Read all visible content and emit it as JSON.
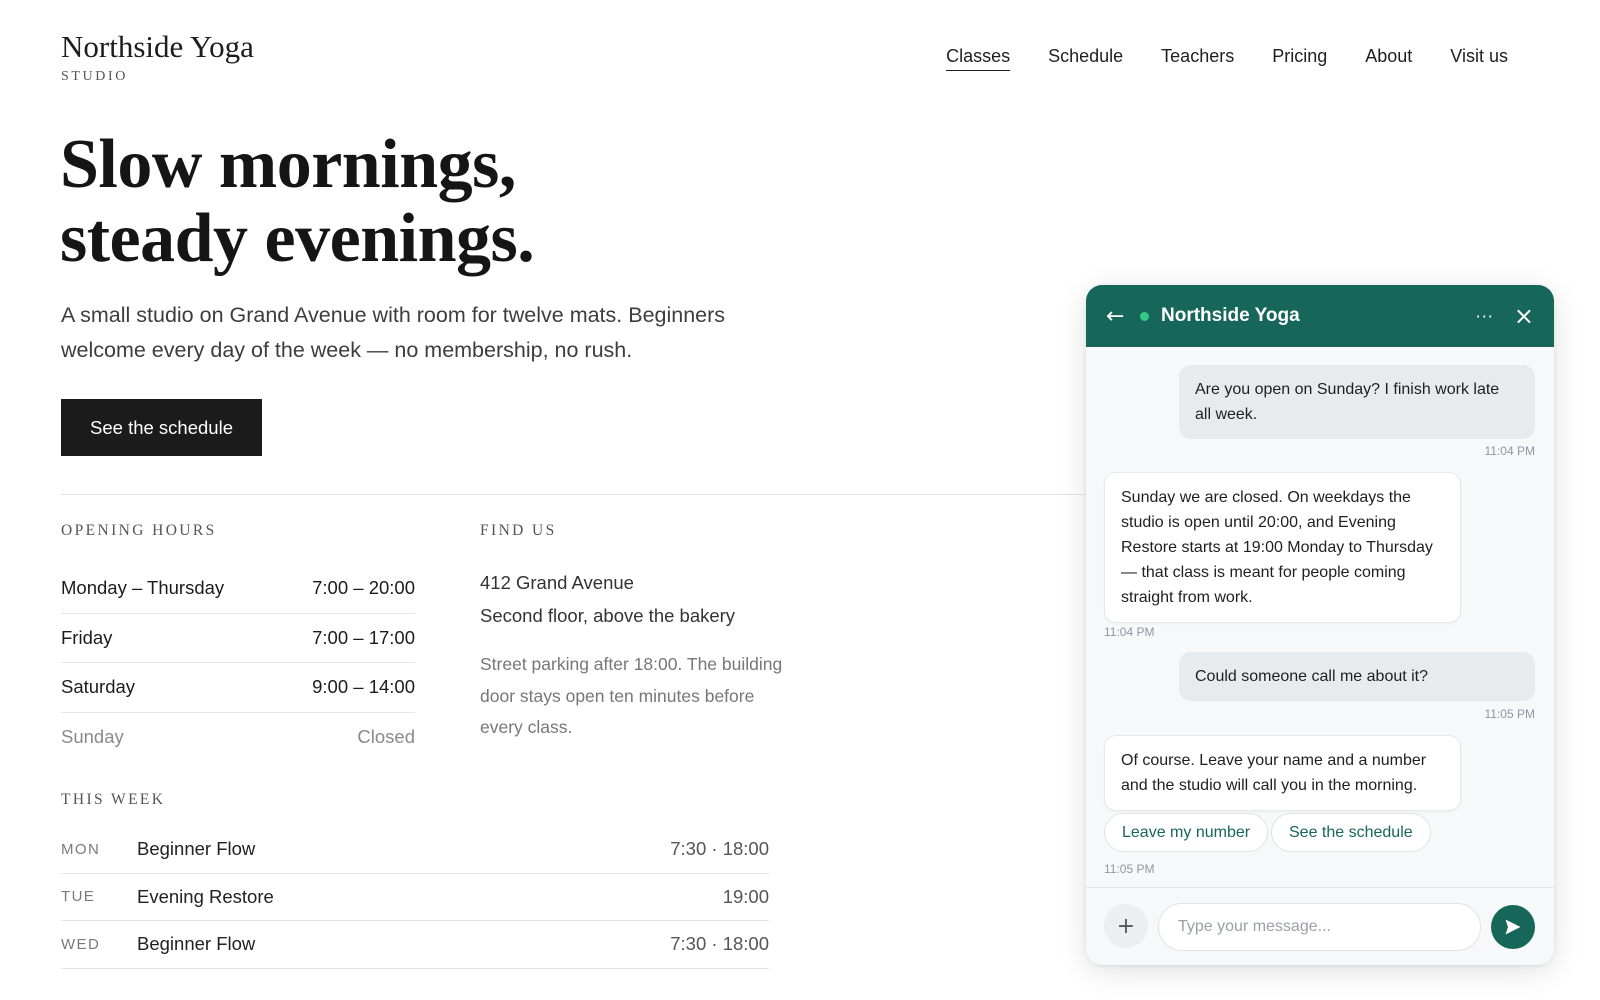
{
  "brand": {
    "name": "Northside Yoga",
    "subtitle": "STUDIO"
  },
  "nav": {
    "items": [
      {
        "label": "Classes",
        "active": true
      },
      {
        "label": "Schedule"
      },
      {
        "label": "Teachers"
      },
      {
        "label": "Pricing"
      },
      {
        "label": "About"
      },
      {
        "label": "Visit us"
      }
    ]
  },
  "hero": {
    "title_line1": "Slow mornings,",
    "title_line2": "steady evenings.",
    "text": "A small studio on Grand Avenue with room for twelve mats. Beginners welcome every day of the week — no membership, no rush.",
    "cta": "See the schedule"
  },
  "hours": {
    "label": "OPENING HOURS",
    "rows": [
      {
        "day": "Monday – Thursday",
        "time": "7:00 – 20:00"
      },
      {
        "day": "Friday",
        "time": "7:00 – 17:00"
      },
      {
        "day": "Saturday",
        "time": "9:00 – 14:00"
      },
      {
        "day": "Sunday",
        "time": "Closed"
      }
    ]
  },
  "find_us": {
    "label": "FIND US",
    "address_line1": "412 Grand Avenue",
    "address_line2": "Second floor, above the bakery",
    "note": "Street parking after 18:00. The building door stays open ten minutes before every class."
  },
  "this_week": {
    "label": "THIS WEEK",
    "rows": [
      {
        "day": "MON",
        "class": "Beginner Flow",
        "time": "7:30 · 18:00"
      },
      {
        "day": "TUE",
        "class": "Evening Restore",
        "time": "19:00"
      },
      {
        "day": "WED",
        "class": "Beginner Flow",
        "time": "7:30 · 18:00"
      }
    ]
  },
  "chat": {
    "title": "Northside Yoga",
    "back_icon": "arrow-left-icon",
    "more_icon": "ellipsis-icon",
    "close_icon": "close-icon",
    "messages": [
      {
        "from": "user",
        "text": "Are you open on Sunday? I finish work late all week.",
        "time": "11:04 PM"
      },
      {
        "from": "bot",
        "text": "Sunday we are closed. On weekdays the studio is open until 20:00, and Evening Restore starts at 19:00 Monday to Thursday — that class is meant for people coming straight from work.",
        "time": "11:04 PM"
      },
      {
        "from": "user",
        "text": "Could someone call me about it?",
        "time": "11:05 PM"
      },
      {
        "from": "bot",
        "text": "Of course. Leave your name and a number and the studio will call you in the morning.",
        "time": "11:05 PM"
      }
    ],
    "quick_replies": [
      "Leave my number",
      "See the schedule"
    ],
    "input_placeholder": "Type your message...",
    "colors": {
      "header": "#16675a",
      "online": "#33c98a",
      "user_bubble": "#e8ebee"
    }
  }
}
